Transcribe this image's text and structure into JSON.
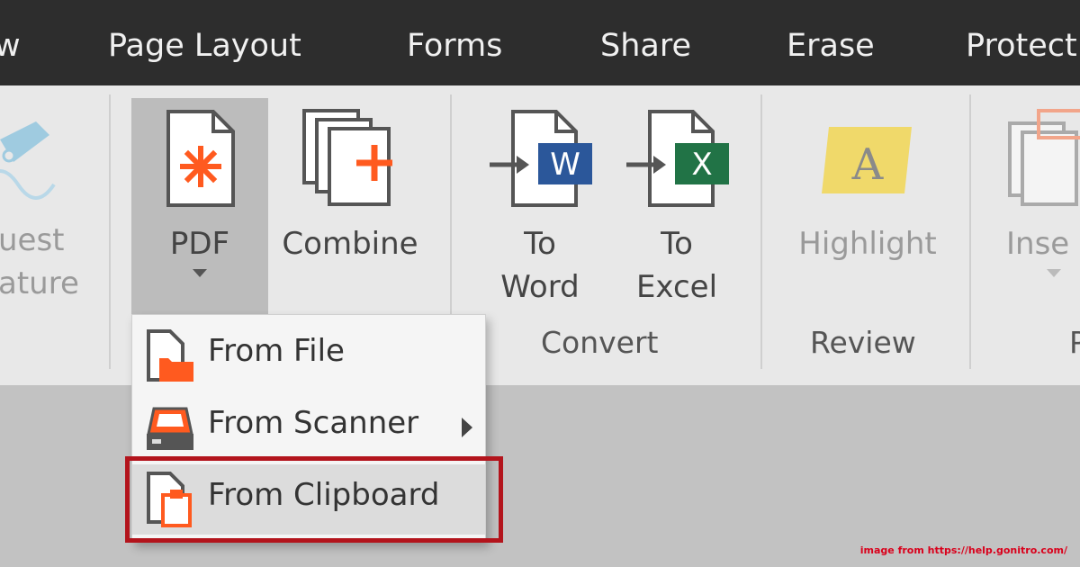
{
  "menu": {
    "tabs": [
      "w",
      "Page Layout",
      "Forms",
      "Share",
      "Erase",
      "Protect"
    ]
  },
  "ribbon": {
    "request_signature": [
      "uest",
      "ature"
    ],
    "pdf": "PDF",
    "combine": "Combine",
    "to_word": [
      "To",
      "Word"
    ],
    "to_excel": [
      "To",
      "Excel"
    ],
    "highlight": "Highlight",
    "insert": "Inse",
    "groups": {
      "convert": "Convert",
      "review": "Review",
      "partial": "P"
    }
  },
  "dropdown": {
    "from_file": "From File",
    "from_scanner": "From Scanner",
    "from_clipboard": "From Clipboard"
  },
  "credit": "image from https://help.gonitro.com/",
  "colors": {
    "accent_orange": "#ff5a1f",
    "word_blue": "#2b579a",
    "excel_green": "#217346",
    "highlight_yellow": "#f0d96a",
    "red_frame": "#b3141c"
  }
}
